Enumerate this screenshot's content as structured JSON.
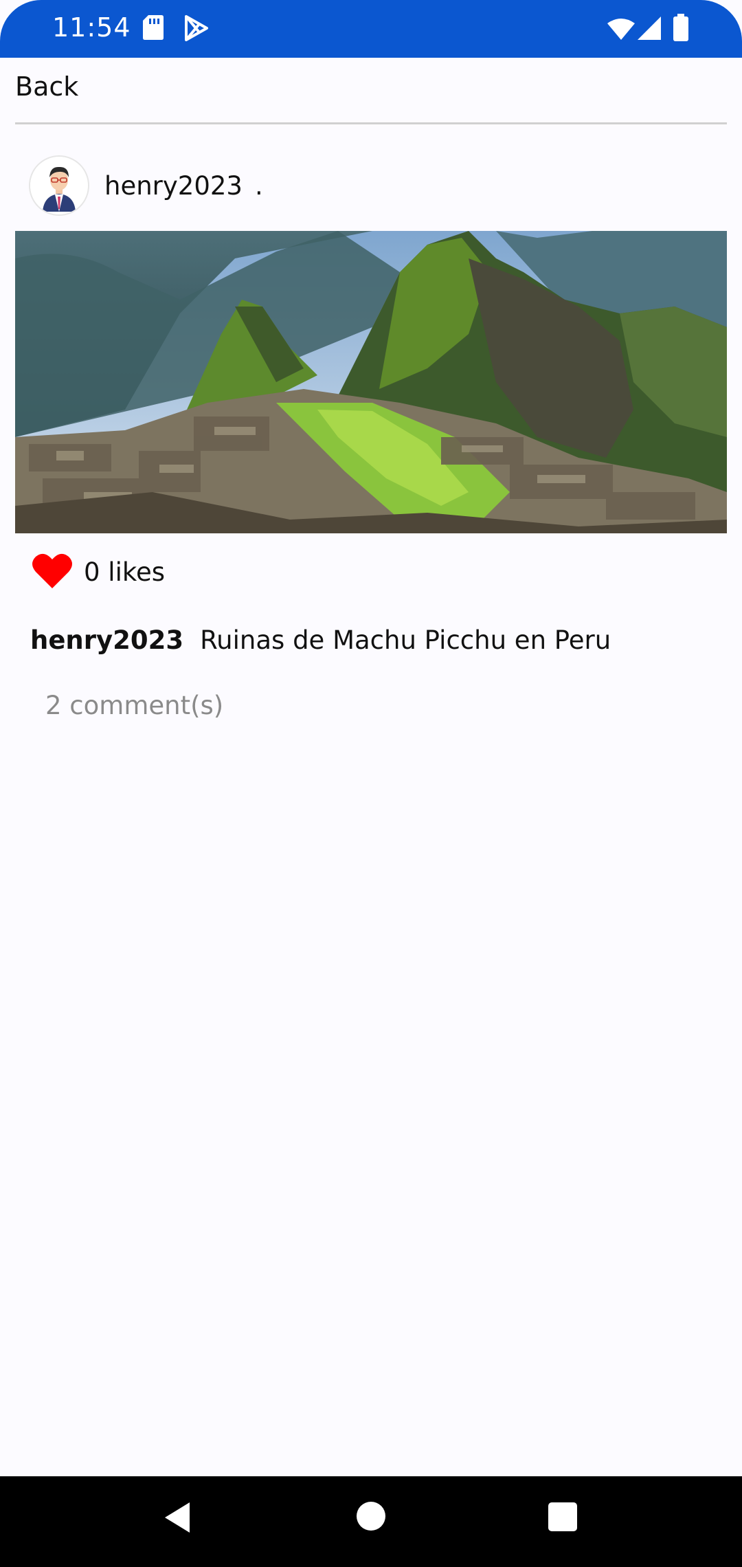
{
  "status_bar": {
    "time": "11:54",
    "left_icons": [
      "sd-card-icon",
      "play-store-icon"
    ],
    "right_icons": [
      "wifi-icon",
      "cellular-signal-icon",
      "battery-icon"
    ],
    "color": "#0b57d0"
  },
  "header": {
    "back_label": "Back"
  },
  "post": {
    "username": "henry2023",
    "meta": ".",
    "image_subject": "Machu Picchu ruins",
    "likes_label": "0 likes",
    "like_icon_color": "#ff0000",
    "caption_user": "henry2023",
    "caption_text": "Ruinas de Machu Picchu en Peru",
    "comments_label": "2 comment(s)"
  },
  "nav_bar": {
    "buttons": [
      "back-triangle-icon",
      "home-circle-icon",
      "recents-square-icon"
    ]
  }
}
